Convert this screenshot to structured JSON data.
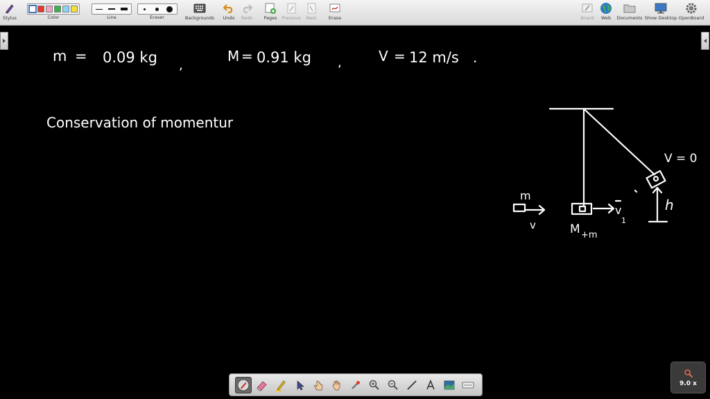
{
  "toolbar": {
    "stylus": "Stylus",
    "color": "Color",
    "line": "Line",
    "eraser": "Eraser",
    "backgrounds": "Backgrounds",
    "undo": "Undo",
    "redo": "Redo",
    "pages": "Pages",
    "previous": "Previous",
    "next": "Next",
    "erase": "Erase",
    "board": "Board",
    "web": "Web",
    "documents": "Documents",
    "show_desktop": "Show Desktop",
    "openboard": "OpenBoard"
  },
  "colors": {
    "swatches": [
      "#ffffff",
      "#e53a2a",
      "#f2a3c8",
      "#37b24d",
      "#8fd3f7",
      "#f3e13a"
    ],
    "selected_swatch": 0,
    "board_background": "#000000",
    "ink": "#ffffff"
  },
  "board": {
    "line1": {
      "m": "m",
      "eq1": "=",
      "m_value": "0.09 kg",
      "sep1": ",",
      "M": "M",
      "eq2": "=",
      "M_value": "0.91 kg",
      "sep2": ",",
      "v": "V",
      "eq3": "=",
      "v_value": "12 m/s",
      "end": "."
    },
    "line2": "Conservation of momentur",
    "diagram": {
      "label_m": "m",
      "label_v": "v",
      "label_v1": "v",
      "label_v1_sub": "1",
      "label_Mm": "M",
      "label_Mm_sub": "+m",
      "label_h": "h",
      "label_v0": "V = 0"
    }
  },
  "palette": {
    "tools": [
      "pen-icon",
      "eraser-icon",
      "marker-icon",
      "selector-icon",
      "interact-icon",
      "hand-icon",
      "laser-pointer-icon",
      "zoom-in-icon",
      "zoom-out-icon",
      "line-icon",
      "text-icon",
      "capture-icon",
      "virtual-keyboard-icon"
    ],
    "active_tool": 0
  },
  "zoom": {
    "value": "9.0 x"
  }
}
